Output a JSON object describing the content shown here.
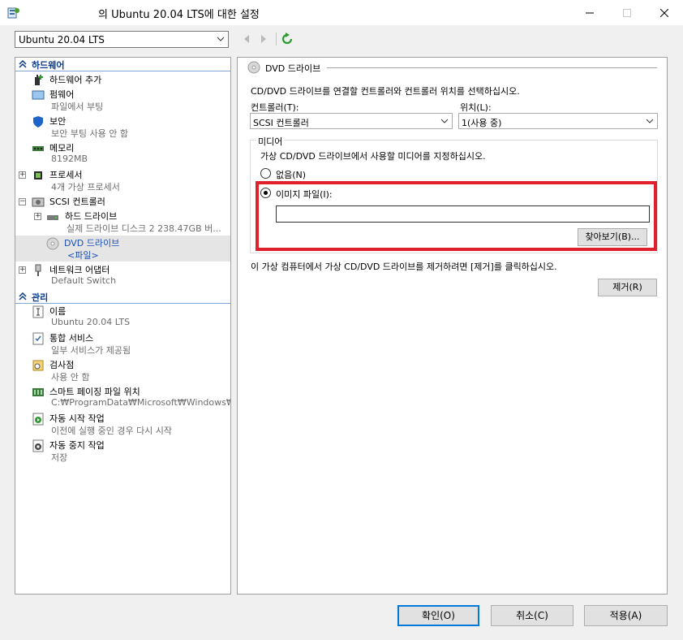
{
  "window": {
    "title": "의 Ubuntu 20.04 LTS에 대한 설정"
  },
  "vm_selector": {
    "value": "Ubuntu 20.04 LTS"
  },
  "left": {
    "hardware_section": "하드웨어",
    "management_section": "관리",
    "hardware_items": [
      {
        "name": "하드웨어 추가",
        "sub": ""
      },
      {
        "name": "펌웨어",
        "sub": "파일에서 부팅"
      },
      {
        "name": "보안",
        "sub": "보안 부팅 사용 안 함"
      },
      {
        "name": "메모리",
        "sub": "8192MB"
      },
      {
        "name": "프로세서",
        "sub": "4개 가상 프로세서"
      },
      {
        "name": "SCSI 컨트롤러",
        "sub": ""
      },
      {
        "name": "하드 드라이브",
        "sub": "실제 드라이브 디스크 2 238.47GB 버..."
      },
      {
        "name": "DVD 드라이브",
        "sub": "<파일>"
      },
      {
        "name": "네트워크 어댑터",
        "sub": "Default Switch"
      }
    ],
    "management_items": [
      {
        "name": "이름",
        "sub": "Ubuntu 20.04 LTS"
      },
      {
        "name": "통합 서비스",
        "sub": "일부 서비스가 제공됨"
      },
      {
        "name": "검사점",
        "sub": "사용 안 함"
      },
      {
        "name": "스마트 페이징 파일 위치",
        "sub": "C:₩ProgramData₩Microsoft₩Windows₩..."
      },
      {
        "name": "자동 시작 작업",
        "sub": "이전에 실행 중인 경우 다시 시작"
      },
      {
        "name": "자동 중지 작업",
        "sub": "저장"
      }
    ]
  },
  "right": {
    "header": "DVD 드라이브",
    "description": "CD/DVD 드라이브를 연결할 컨트롤러와 컨트롤러 위치를 선택하십시오.",
    "controller_label": "컨트롤러(T):",
    "controller_value": "SCSI 컨트롤러",
    "location_label": "위치(L):",
    "location_value": "1(사용 중)",
    "media_group": "미디어",
    "media_description": "가상 CD/DVD 드라이브에서 사용할 미디어를 지정하십시오.",
    "option_none": "없음(N)",
    "option_image": "이미지 파일(I):",
    "image_path": "",
    "browse_button": "찾아보기(B)...",
    "remove_description": "이 가상 컴퓨터에서 가상 CD/DVD 드라이브를 제거하려면 [제거]를 클릭하십시오.",
    "remove_button": "제거(R)"
  },
  "footer": {
    "ok": "확인(O)",
    "cancel": "취소(C)",
    "apply": "적용(A)"
  },
  "colors": {
    "accent": "#0078d7",
    "highlight_box": "#e0202a",
    "section_text": "#0a3a8a",
    "selected_text": "#1a4fb5"
  }
}
